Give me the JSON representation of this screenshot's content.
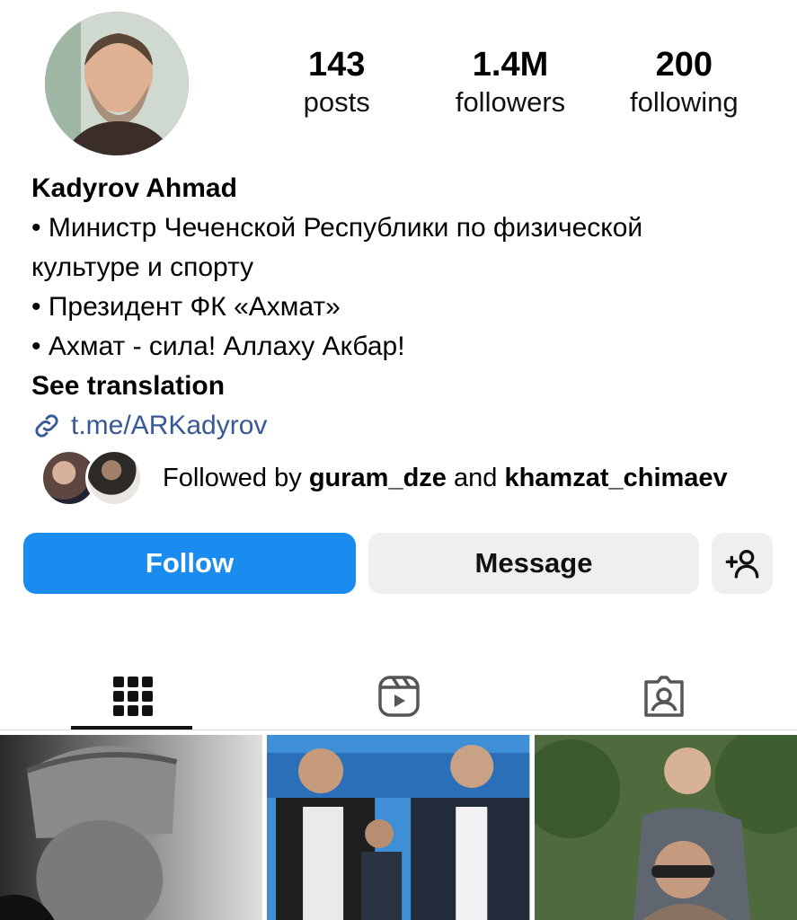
{
  "profile": {
    "avatar_icon": "profile-photo",
    "stats": [
      {
        "value": "143",
        "label": "posts"
      },
      {
        "value": "1.4M",
        "label": "followers"
      },
      {
        "value": "200",
        "label": "following"
      }
    ],
    "name": "Kadyrov Ahmad",
    "bio_lines": [
      "• Министр Чеченской Республики по физической",
      "культуре и спорту",
      "• Президент ФК «Ахмат»",
      "• Ахмат - сила! Аллаху Акбар!"
    ],
    "see_translation": "See translation",
    "link": "t.me/ARKadyrov",
    "followed_by": {
      "prefix": "Followed by",
      "user1": "guram_dze",
      "joiner": "and",
      "user2": "khamzat_chimaev"
    }
  },
  "actions": {
    "follow_label": "Follow",
    "message_label": "Message",
    "add_icon": "add-person-icon"
  },
  "tabs": [
    {
      "name": "posts-grid",
      "icon": "grid-icon",
      "active": true
    },
    {
      "name": "reels",
      "icon": "reels-icon",
      "active": false
    },
    {
      "name": "tagged",
      "icon": "tagged-icon",
      "active": false
    }
  ],
  "colors": {
    "follow_button": "#1a8cf0",
    "link": "#385898",
    "secondary_button": "#efefef"
  }
}
